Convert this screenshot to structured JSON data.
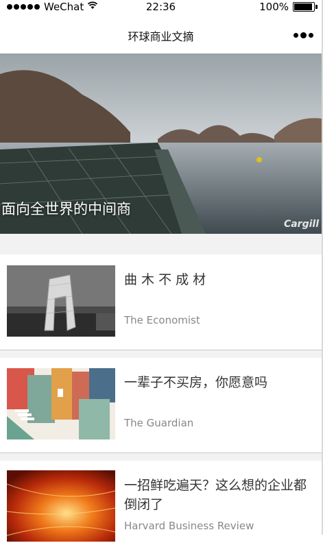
{
  "status_bar": {
    "carrier": "WeChat",
    "time": "22:36",
    "battery": "100%"
  },
  "nav": {
    "title": "环球商业文摘"
  },
  "hero": {
    "caption": "面向全世界的中间商",
    "watermark": "Cargill"
  },
  "articles": [
    {
      "title": "曲 木 不 成 材",
      "source": "The Economist"
    },
    {
      "title": "一辈子不买房，你愿意吗",
      "source": "The Guardian"
    },
    {
      "title": "一招鲜吃遍天？这么想的企业都倒闭了",
      "source": "Harvard Business Review"
    }
  ]
}
